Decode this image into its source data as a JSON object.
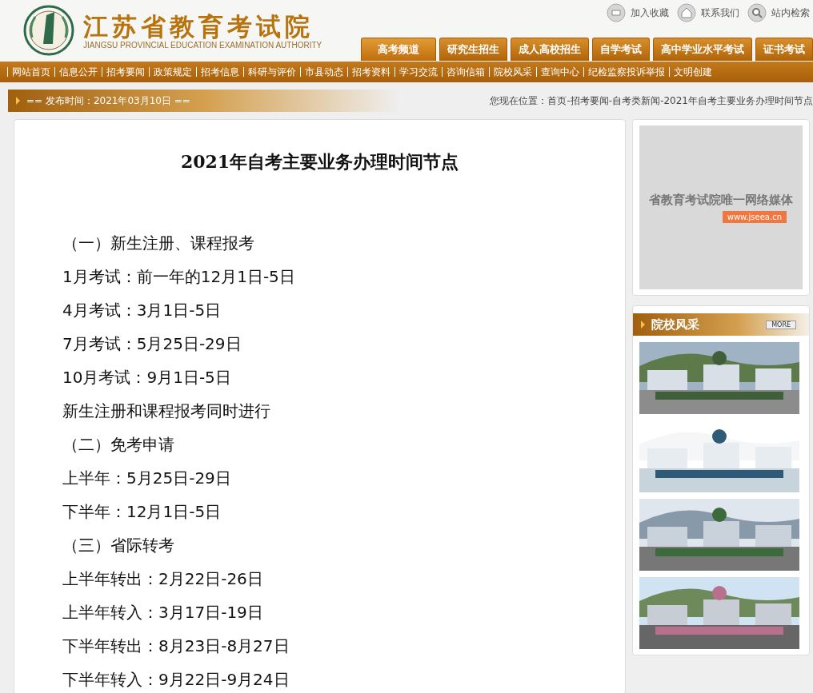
{
  "header": {
    "title": "江苏省教育考试院",
    "subtitle": "JIANGSU PROVINCIAL EDUCATION EXAMINATION AUTHORITY",
    "links": [
      {
        "kind": "bookmark",
        "label": "加入收藏"
      },
      {
        "kind": "home",
        "label": "联系我们"
      },
      {
        "kind": "search",
        "label": "站内检索"
      }
    ],
    "tabs": [
      {
        "label": "高考频道",
        "selected": true
      },
      {
        "label": "研究生招生",
        "selected": false
      },
      {
        "label": "成人高校招生",
        "selected": false
      },
      {
        "label": "自学考试",
        "selected": false
      },
      {
        "label": "高中学业水平考试",
        "selected": false
      },
      {
        "label": "证书考试",
        "selected": false
      }
    ]
  },
  "nav": [
    "网站首页",
    "信息公开",
    "招考要闻",
    "政策规定",
    "招考信息",
    "科研与评价",
    "市县动态",
    "招考资料",
    "学习交流",
    "咨询信箱",
    "院校风采",
    "查询中心",
    "纪检监察投诉举报",
    "文明创建"
  ],
  "info_bar": {
    "date": "== 发布时间：2021年03月10日 ==",
    "breadcrumb": "您现在位置：首页-招考要闻-自考类新闻-2021年自考主要业务办理时间节点"
  },
  "article": {
    "title": "2021年自考主要业务办理时间节点",
    "lines": [
      "（一）新生注册、课程报考",
      "1月考试：前一年的12月1日-5日",
      "4月考试：3月1日-5日",
      "7月考试：5月25日-29日",
      "10月考试：9月1日-5日",
      "新生注册和课程报考同时进行",
      "（二）免考申请",
      "上半年：5月25日-29日",
      "下半年：12月1日-5日",
      "（三）省际转考",
      "上半年转出：2月22日-26日",
      "上半年转入：3月17日-19日",
      "下半年转出：8月23日-8月27日",
      "下半年转入：9月22日-9月24日"
    ]
  },
  "sidebar": {
    "ad": {
      "text": "省教育考试院唯一网络媒体",
      "url": "www.jseea.cn"
    },
    "section": {
      "title": "院校风采",
      "more": "MORE"
    }
  }
}
